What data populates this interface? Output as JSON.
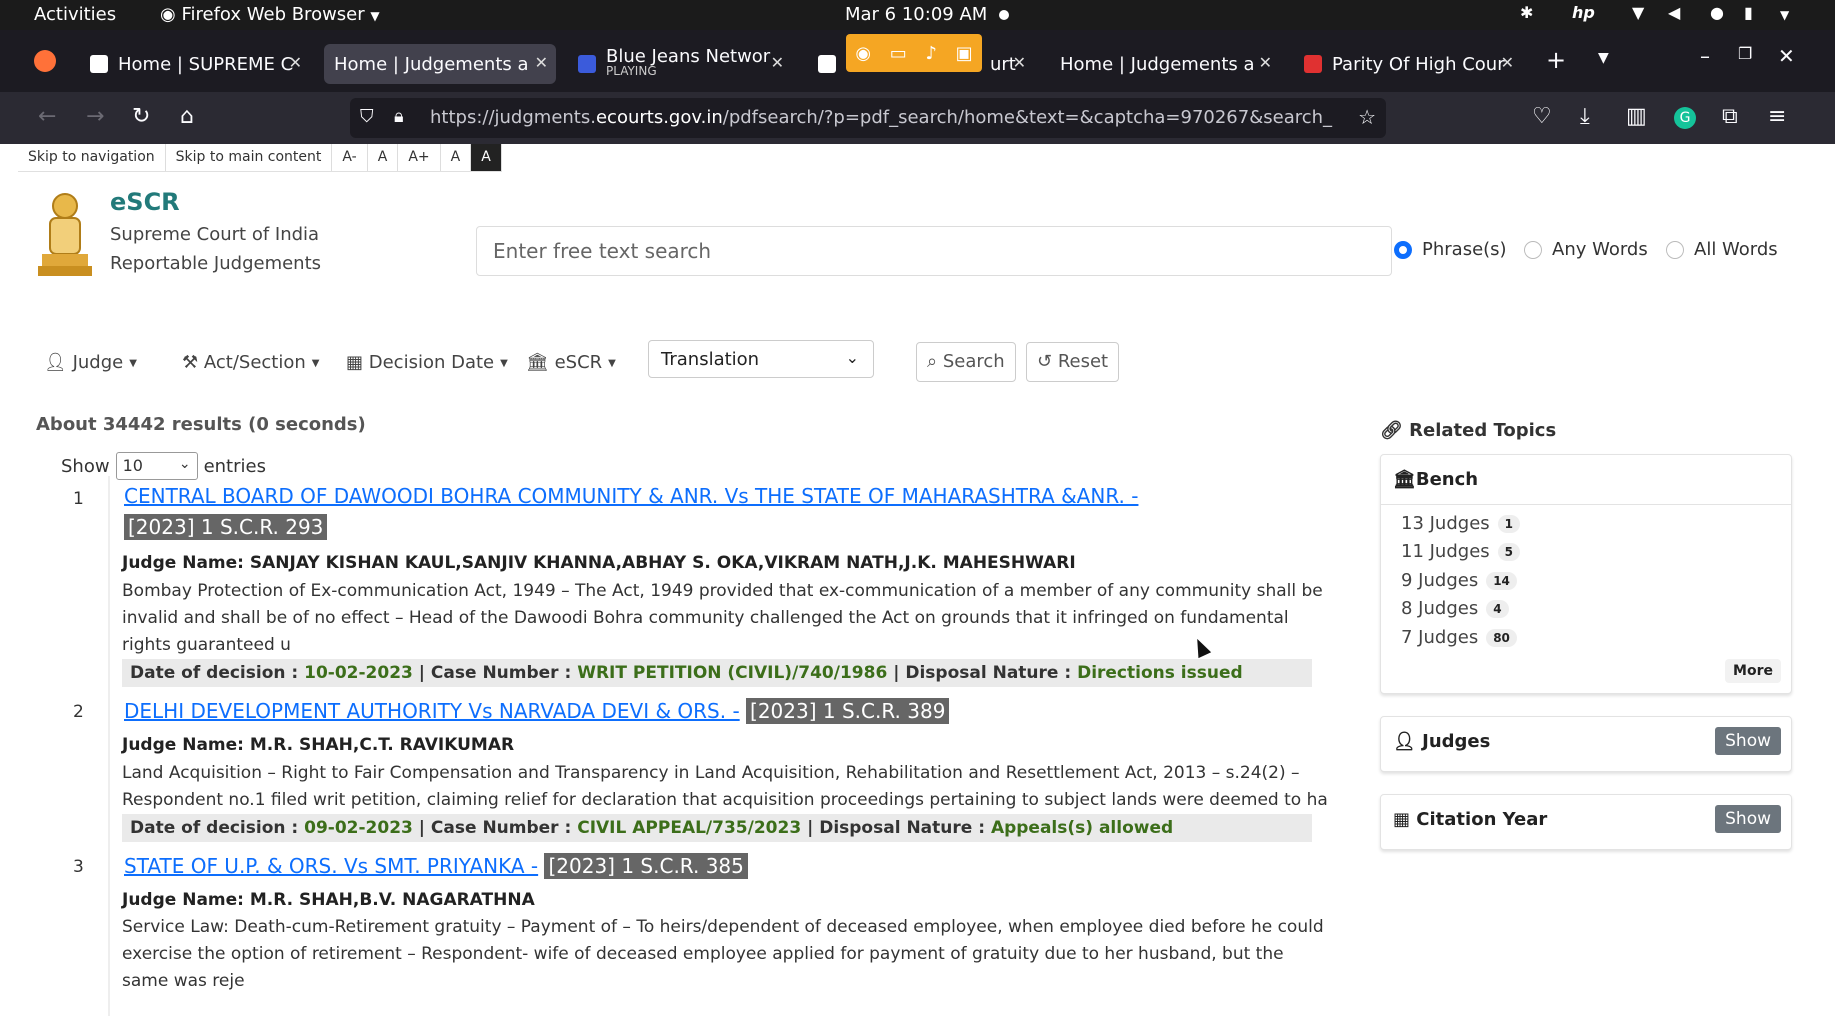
{
  "system_bar": {
    "activities": "Activities",
    "app_name": "Firefox Web Browser",
    "datetime": "Mar 6  10:09 AM"
  },
  "tabs": [
    {
      "title": "Home | SUPREME C",
      "favicon_color": "#ffffff"
    },
    {
      "title": "Home | Judgements a",
      "favicon_color": "#ffffff"
    },
    {
      "title": "Blue Jeans Networ",
      "subtitle": "PLAYING",
      "favicon_color": "#3b5bdb"
    },
    {
      "title": "urt",
      "favicon_color": "#ffffff"
    },
    {
      "title": "Home | Judgements a",
      "favicon_color": "#ffffff"
    },
    {
      "title": "Parity Of High Cour",
      "favicon_color": "#e03131"
    }
  ],
  "url": {
    "prefix": "https://judgments.",
    "domain": "ecourts.gov.in",
    "suffix": "/pdfsearch/?p=pdf_search/home&text=&captcha=970267&search_"
  },
  "a11y_bar": [
    "Skip to navigation",
    "Skip to main content",
    "A-",
    "A",
    "A+",
    "A",
    "A"
  ],
  "brand": {
    "title": "eSCR",
    "line1": "Supreme Court of India",
    "line2": "Reportable Judgements"
  },
  "search": {
    "placeholder": "Enter free text search"
  },
  "search_modes": [
    {
      "label": "Phrase(s)",
      "selected": true
    },
    {
      "label": "Any Words",
      "selected": false
    },
    {
      "label": "All Words",
      "selected": false
    }
  ],
  "filters": {
    "judge": "Judge",
    "act_section": "Act/Section",
    "decision_date": "Decision Date",
    "escr": "eSCR",
    "translation": "Translation",
    "search_btn": "Search",
    "reset_btn": "Reset"
  },
  "results_meta": "About 34442 results (0 seconds)",
  "entries": {
    "show": "Show",
    "value": "10",
    "suffix": "entries"
  },
  "results": [
    {
      "num": "1",
      "title": "CENTRAL BOARD OF DAWOODI BOHRA COMMUNITY & ANR. Vs THE STATE OF MAHARASHTRA &ANR. -",
      "citation": "[2023] 1 S.C.R. 293",
      "judges": "Judge Name: SANJAY KISHAN KAUL,SANJIV KHANNA,ABHAY S. OKA,VIKRAM NATH,J.K. MAHESHWARI",
      "summary": "Bombay Protection of Ex-communication Act, 1949 – The Act, 1949 provided that ex-communication of a member of any community shall be invalid and shall be of no effect – Head of the Dawoodi Bohra community challenged the Act on grounds that it infringed on fundamental rights guaranteed u",
      "date_label": "Date of decision :",
      "date": "10-02-2023",
      "case_label": "| Case Number :",
      "case": "WRIT PETITION (CIVIL)/740/1986",
      "disposal_label": "| Disposal Nature :",
      "disposal": "Directions issued"
    },
    {
      "num": "2",
      "title": "DELHI DEVELOPMENT AUTHORITY Vs NARVADA DEVI & ORS. -",
      "citation": "[2023] 1 S.C.R. 389",
      "judges": "Judge Name: M.R. SHAH,C.T. RAVIKUMAR",
      "summary": "Land Acquisition – Right to Fair Compensation and Transparency in Land Acquisition, Rehabilitation and Resettlement Act, 2013 – s.24(2) – Respondent no.1 filed writ petition, claiming relief for declaration that acquisition proceedings pertaining to subject lands were deemed to ha",
      "date_label": "Date of decision :",
      "date": "09-02-2023",
      "case_label": "| Case Number :",
      "case": "CIVIL APPEAL/735/2023",
      "disposal_label": "| Disposal Nature :",
      "disposal": "Appeals(s) allowed"
    },
    {
      "num": "3",
      "title": "STATE OF U.P. & ORS. Vs SMT. PRIYANKA -",
      "citation": "[2023] 1 S.C.R. 385",
      "judges": "Judge Name: M.R. SHAH,B.V. NAGARATHNA",
      "summary": "Service Law: Death-cum-Retirement gratuity – Payment of – To heirs/dependent of deceased employee, when employee died before he could exercise the option of retirement – Respondent- wife of deceased employee applied for payment of gratuity due to her husband, but the same was reje"
    }
  ],
  "sidebar": {
    "related_topics": "Related Topics",
    "bench": {
      "title": "Bench",
      "rows": [
        {
          "label": "13 Judges",
          "count": "1"
        },
        {
          "label": "11 Judges",
          "count": "5"
        },
        {
          "label": "9 Judges",
          "count": "14"
        },
        {
          "label": "8 Judges",
          "count": "4"
        },
        {
          "label": "7 Judges",
          "count": "80"
        }
      ],
      "more": "More"
    },
    "judges": {
      "title": "Judges",
      "show": "Show"
    },
    "citation_year": {
      "title": "Citation Year",
      "show": "Show"
    }
  }
}
